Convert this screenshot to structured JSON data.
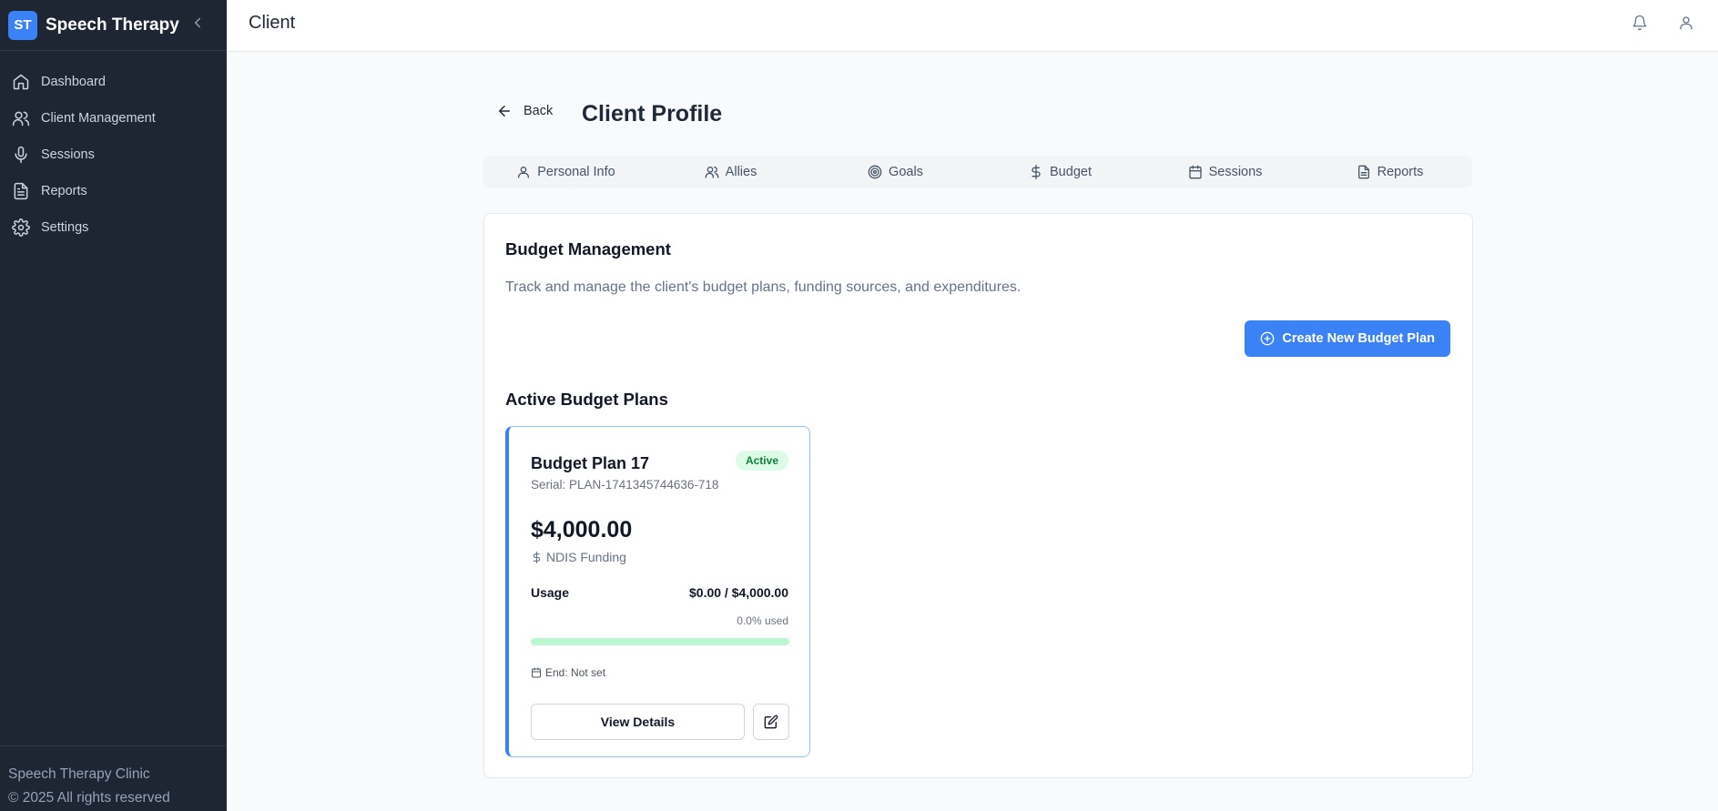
{
  "sidebar": {
    "logo_text": "ST",
    "brand": "Speech Therapy",
    "items": [
      {
        "label": "Dashboard",
        "icon": "home-icon"
      },
      {
        "label": "Client Management",
        "icon": "users-icon"
      },
      {
        "label": "Sessions",
        "icon": "microphone-icon"
      },
      {
        "label": "Reports",
        "icon": "file-text-icon"
      },
      {
        "label": "Settings",
        "icon": "gear-icon"
      }
    ],
    "footer_line1": "Speech Therapy Clinic",
    "footer_line2": "© 2025 All rights reserved"
  },
  "topbar": {
    "title": "Client",
    "icons": [
      "bell-icon",
      "user-icon"
    ]
  },
  "header": {
    "back_label": "Back",
    "page_title": "Client Profile"
  },
  "tabs": [
    {
      "label": "Personal Info",
      "icon": "user-icon"
    },
    {
      "label": "Allies",
      "icon": "users-icon"
    },
    {
      "label": "Goals",
      "icon": "target-icon"
    },
    {
      "label": "Budget",
      "icon": "dollar-icon"
    },
    {
      "label": "Sessions",
      "icon": "calendar-icon"
    },
    {
      "label": "Reports",
      "icon": "file-text-icon"
    }
  ],
  "budget": {
    "title": "Budget Management",
    "description": "Track and manage the client's budget plans, funding sources, and expenditures.",
    "create_button": "Create New Budget Plan",
    "active_title": "Active Budget Plans",
    "plan": {
      "name": "Budget Plan 17",
      "status": "Active",
      "serial": "Serial: PLAN-1741345744636-718",
      "amount": "$4,000.00",
      "funding": "NDIS Funding",
      "usage_label": "Usage",
      "usage_value": "$0.00 / $4,000.00",
      "used_text": "0.0% used",
      "used_fraction": 0.0,
      "end_text": "End: Not set",
      "view_button": "View Details"
    }
  },
  "colors": {
    "accent": "#3b82f6",
    "sidebar_bg": "#1e2533",
    "active_badge_bg": "#dcfce7",
    "active_badge_text": "#15803d",
    "progress_track": "#bbf7d0"
  }
}
